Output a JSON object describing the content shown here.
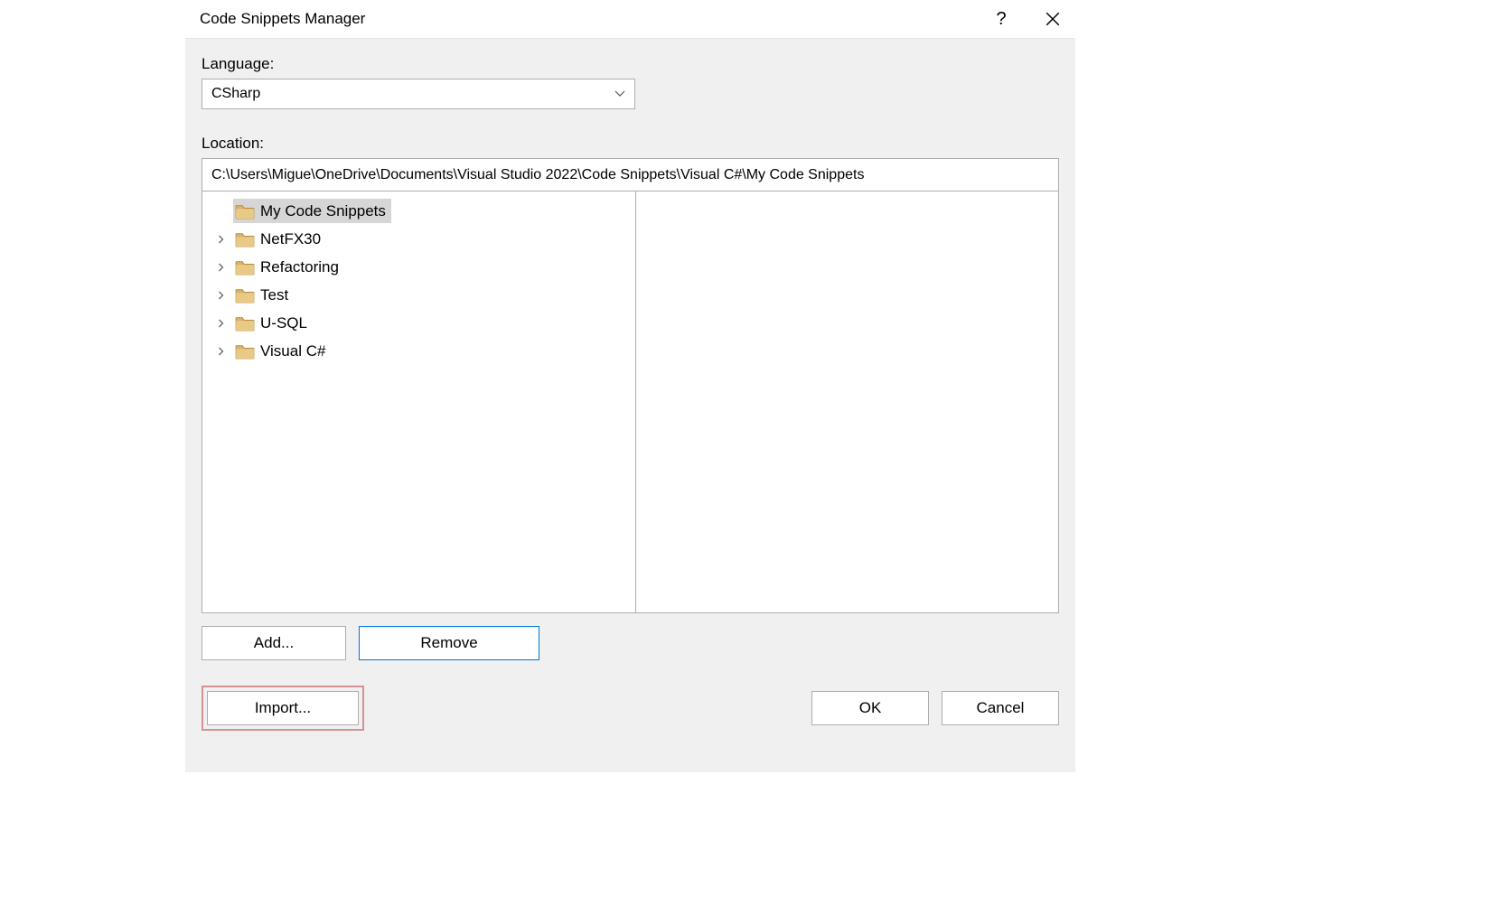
{
  "title": "Code Snippets Manager",
  "help_tooltip": "?",
  "language": {
    "label": "Language:",
    "value": "CSharp"
  },
  "location": {
    "label": "Location:",
    "value": "C:\\Users\\Migue\\OneDrive\\Documents\\Visual Studio 2022\\Code Snippets\\Visual C#\\My Code Snippets"
  },
  "tree": {
    "items": [
      {
        "label": "My Code Snippets",
        "expandable": false,
        "selected": true
      },
      {
        "label": "NetFX30",
        "expandable": true,
        "selected": false
      },
      {
        "label": "Refactoring",
        "expandable": true,
        "selected": false
      },
      {
        "label": "Test",
        "expandable": true,
        "selected": false
      },
      {
        "label": "U-SQL",
        "expandable": true,
        "selected": false
      },
      {
        "label": "Visual C#",
        "expandable": true,
        "selected": false
      }
    ]
  },
  "buttons": {
    "add": "Add...",
    "remove": "Remove",
    "import": "Import...",
    "ok": "OK",
    "cancel": "Cancel"
  }
}
